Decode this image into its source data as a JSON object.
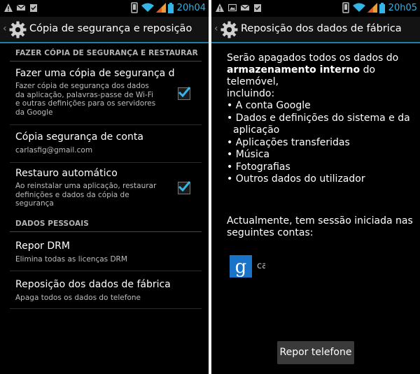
{
  "left": {
    "status_time": "20h04",
    "title": "Cópia de segurança e reposição",
    "section_backup": "FAZER CÓPIA DE SEGURANÇA E RESTAURAR",
    "backup_data": {
      "title": "Fazer uma cópia de segurança d",
      "summary": "Fazer cópia de segurança dos dados da aplicação, palavras-passe de Wi-Fi e outras definições para os servidores da Google",
      "checked": true
    },
    "backup_account": {
      "title": "Cópia segurança de conta",
      "summary": "carlasfig@gmail.com"
    },
    "auto_restore": {
      "title": "Restauro automático",
      "summary": "Ao reinstalar uma aplicação, restaurar definições e dados da cópia de segurança",
      "checked": true
    },
    "section_personal": "DADOS PESSOAIS",
    "drm_reset": {
      "title": "Repor DRM",
      "summary": "Elimina todas as licenças DRM"
    },
    "factory_reset": {
      "title": "Reposição dos dados de fábrica",
      "summary": "Apaga todos os dados do telefone"
    }
  },
  "right": {
    "status_time": "20h05",
    "title": "Reposição dos dados de fábrica",
    "intro_1": "Serão apagados todos os dados do",
    "intro_bold": "armazenamento interno",
    "intro_2": " do telemóvel,",
    "intro_3": "incluindo:",
    "bullets": [
      "• A conta Google",
      "• Dados e definições do sistema e da",
      "  aplicação",
      "• Aplicações transferidas",
      "• Música",
      "• Fotografias",
      "• Outros dados do utilizador"
    ],
    "accounts_line1": "Actualmente, tem sessão iniciada nas",
    "accounts_line2": "seguintes contas:",
    "account_text": "ca",
    "account_icon_letter": "g",
    "reset_button": "Repor telefone"
  },
  "colors": {
    "accent": "#33b5e5",
    "background": "#000000",
    "google_blue": "#1a73c8"
  },
  "icons": {
    "status_left": [
      "warning-icon",
      "mail-icon",
      "clipboard-check-icon"
    ],
    "status_right": [
      "screen-rotation-icon",
      "wifi-icon",
      "signal-icon",
      "battery-icon"
    ],
    "action_bar": "settings-gear-icon",
    "account": "google-icon"
  }
}
